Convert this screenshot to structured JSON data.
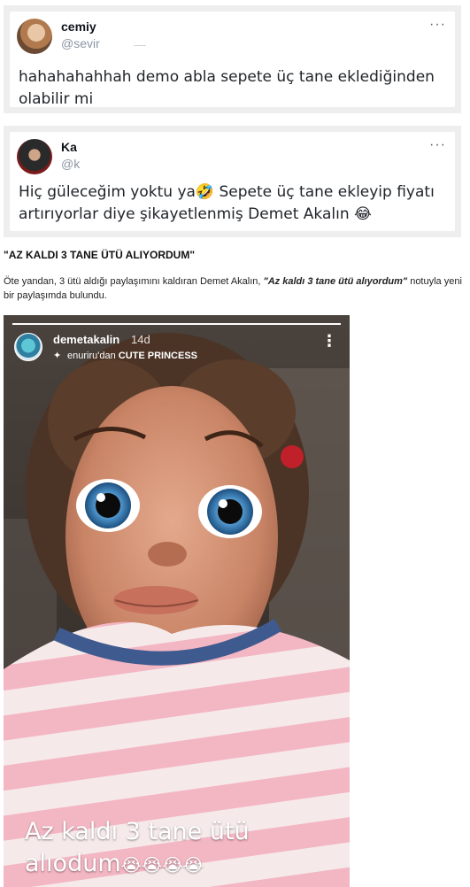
{
  "tweets": [
    {
      "name": "cemiy",
      "handle": "@sevir",
      "more": "···",
      "text": "hahahahahhah demo abla sepete üç tane eklediğinden olabilir mi"
    },
    {
      "name": "Ka",
      "handle": "@k",
      "more": "···",
      "text": "Hiç güleceğim yoktu ya🤣 Sepete üç tane ekleyip fiyatı artırıyorlar diye şikayetlenmiş Demet Akalın 😂"
    }
  ],
  "article": {
    "heading": "\"AZ KALDI 3 TANE ÜTÜ ALIYORDUM\"",
    "paragraph_before": "Öte yandan, 3 ütü aldığı paylaşımını kaldıran Demet Akalın, ",
    "paragraph_quote": "\"Az kaldı 3 tane ütü alıyordum\"",
    "paragraph_after": " notuyla yeni bir paylaşımda bulundu."
  },
  "story": {
    "username": "demetakalin",
    "age": "14d",
    "music_prefix": "enuriru'dan",
    "music_title": "CUTE PRINCESS",
    "more": "⋮",
    "caption_line1": "Az kaldı 3 tane ütü",
    "caption_line2": "alıodum",
    "caption_emoji": "😭😭😭😭",
    "progress": 1.0
  }
}
